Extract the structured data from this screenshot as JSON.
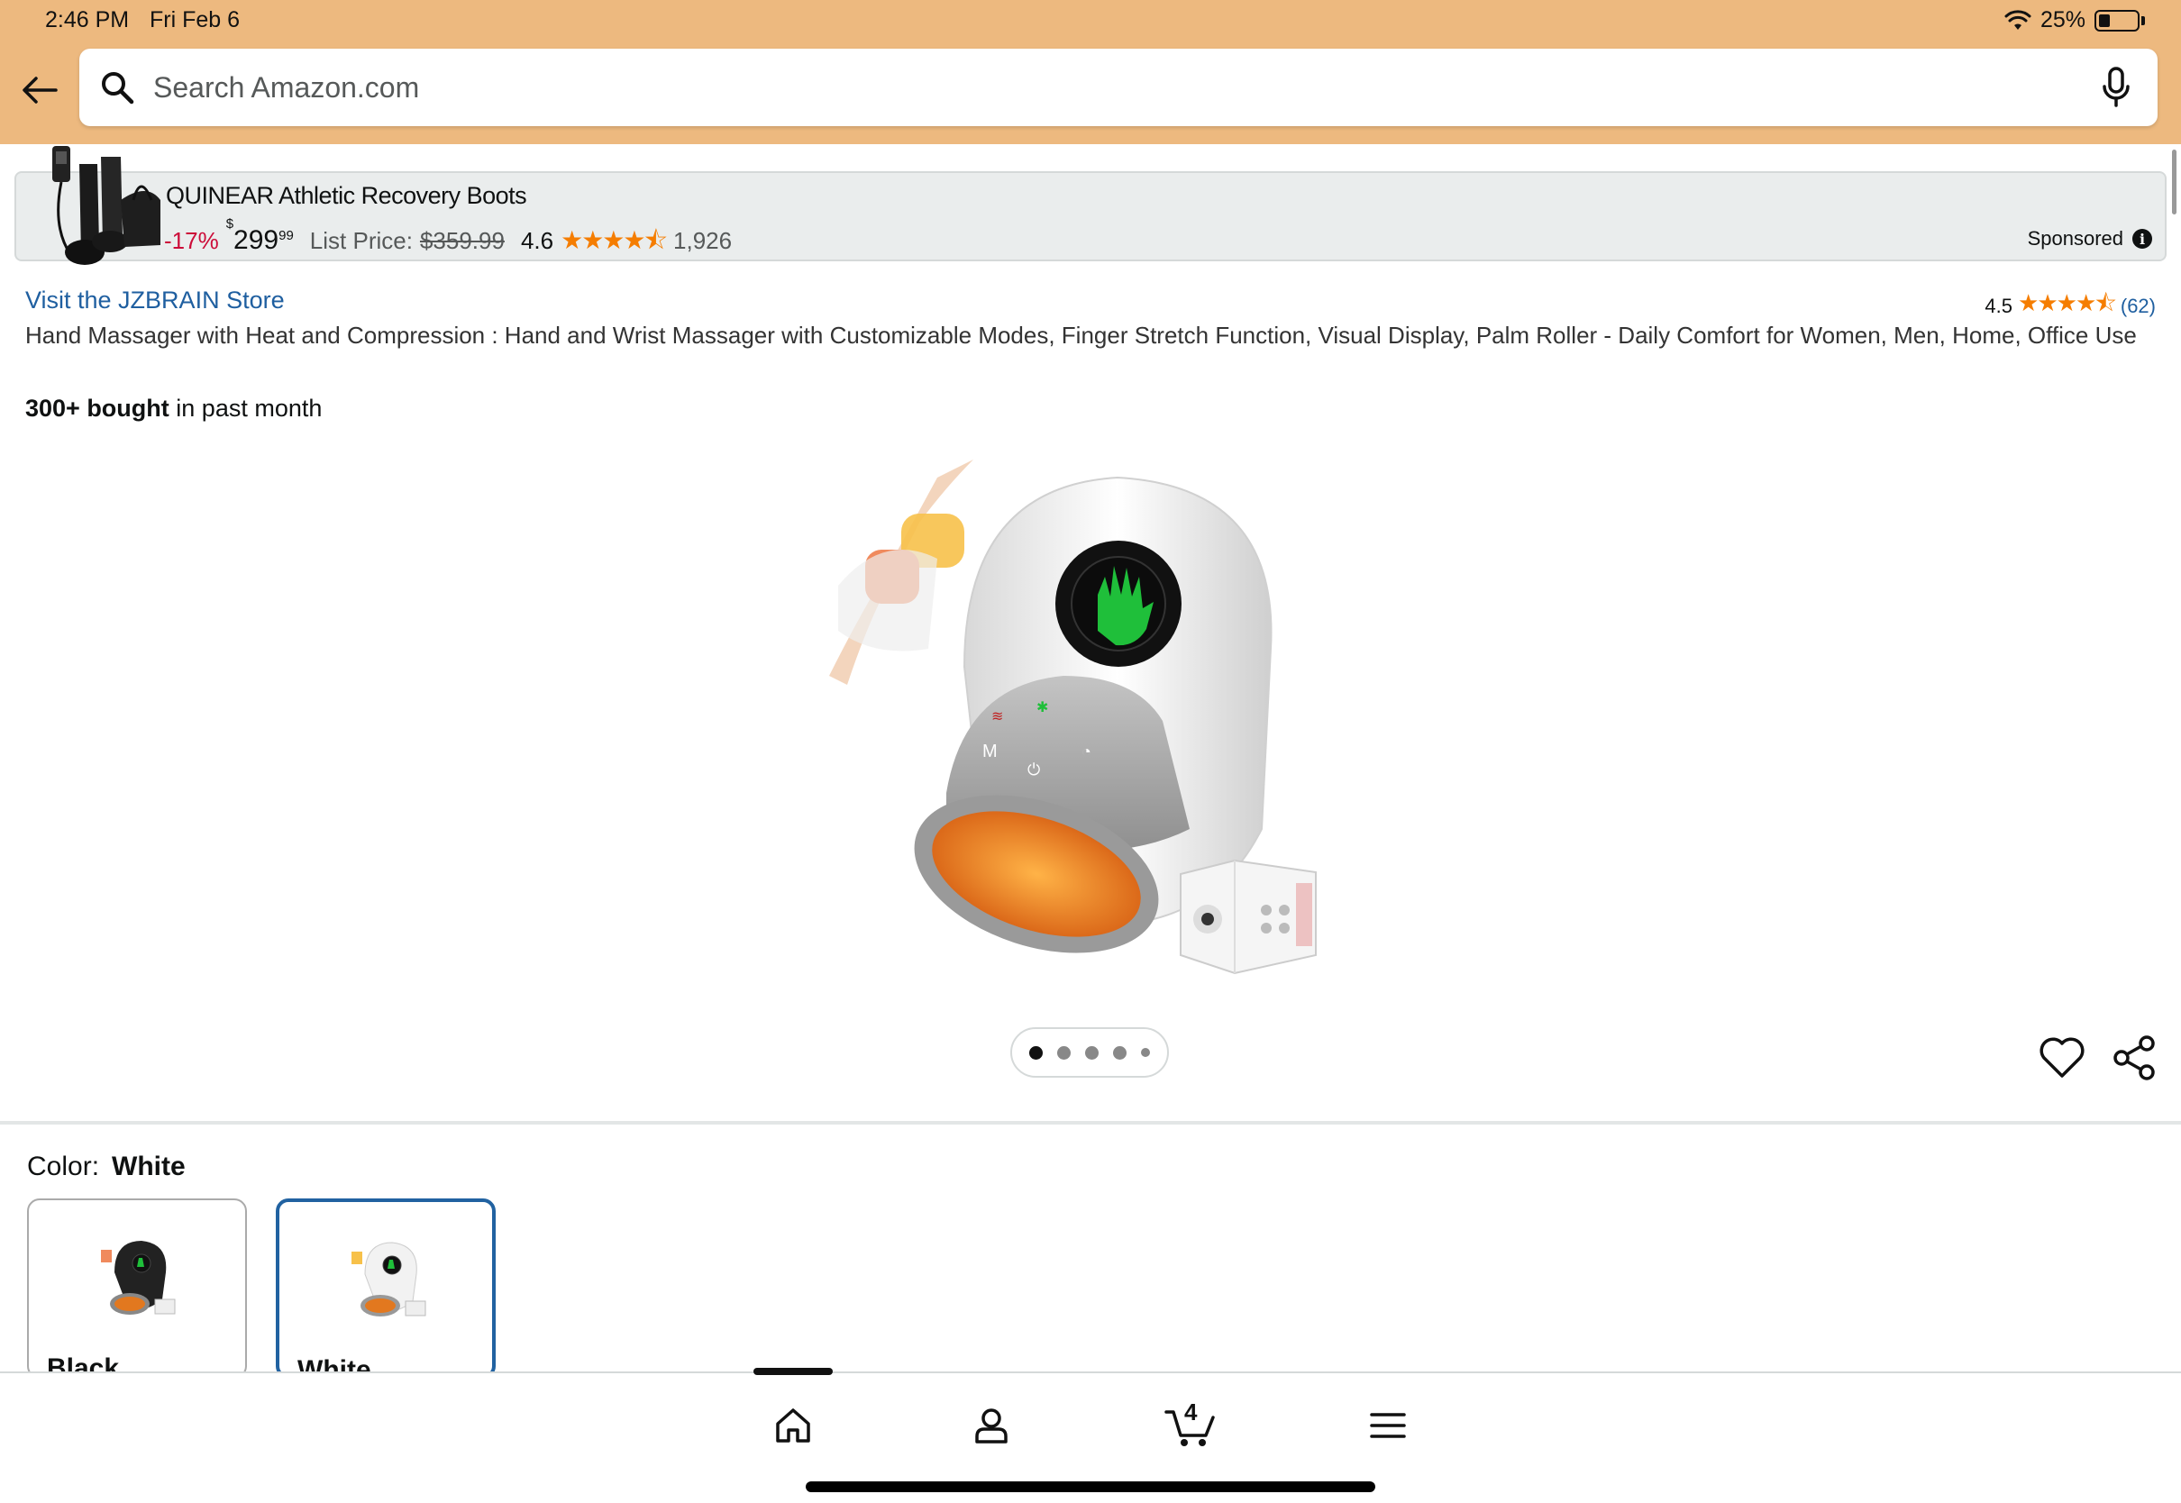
{
  "status_bar": {
    "time": "2:46 PM",
    "date": "Fri Feb 6",
    "battery": "25%"
  },
  "search": {
    "placeholder": "Search Amazon.com"
  },
  "ad": {
    "title": "QUINEAR Athletic Recovery Boots",
    "discount": "-17%",
    "price_symbol": "$",
    "price_whole": "299",
    "price_fraction": "99",
    "list_price_label": "List Price:",
    "list_price": "$359.99",
    "rating": "4.6",
    "rating_count": "1,926",
    "sponsored_label": "Sponsored"
  },
  "product": {
    "store_link": "Visit the JZBRAIN Store",
    "rating": "4.5",
    "review_count": "(62)",
    "title": "Hand Massager with Heat and Compression : Hand and Wrist Massager with Customizable Modes, Finger Stretch Function, Visual Display, Palm Roller - Daily Comfort for Women, Men, Home, Office Use",
    "bought_bold": "300+ bought",
    "bought_rest": " in past month",
    "image_count": 5,
    "active_image": 1
  },
  "color": {
    "label": "Color:",
    "selected": "White",
    "options": [
      {
        "label": "Black"
      },
      {
        "label": "White"
      }
    ]
  },
  "bottom_nav": {
    "cart_count": "4"
  },
  "colors": {
    "header_bg": "#edb97f",
    "star": "#f57d00",
    "link": "#1f5fa0",
    "discount": "#cc0c39",
    "selected_border": "#2162a1"
  }
}
